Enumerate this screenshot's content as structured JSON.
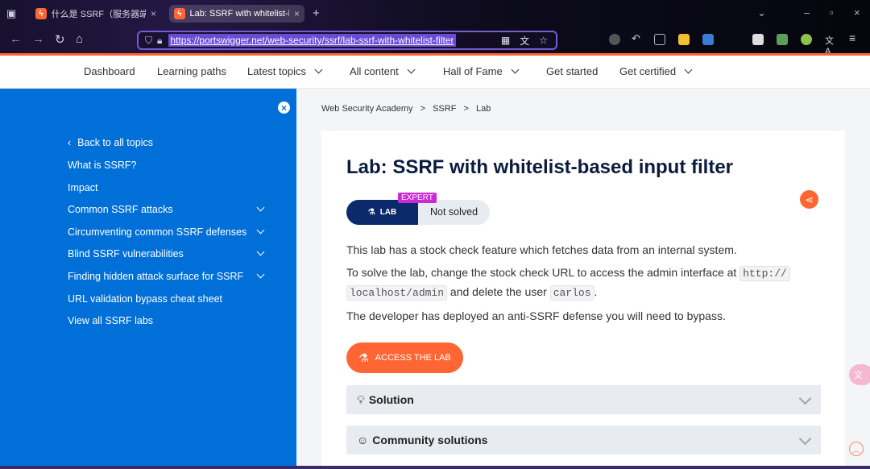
{
  "browser": {
    "tabs": [
      {
        "label": "什么是 SSRF（服务器端请求伪…"
      },
      {
        "label": "Lab: SSRF with whitelist-base"
      }
    ],
    "url": "https://portswigger.net/web-security/ssrf/lab-ssrf-with-whitelist-filter"
  },
  "sitenav": {
    "items": [
      "Dashboard",
      "Learning paths",
      "Latest topics",
      "All content",
      "Hall of Fame",
      "Get started",
      "Get certified"
    ]
  },
  "sidebar": {
    "back_label": "Back to all topics",
    "items": [
      {
        "label": "What is SSRF?"
      },
      {
        "label": "Impact"
      },
      {
        "label": "Common SSRF attacks"
      },
      {
        "label": "Circumventing common SSRF defenses"
      },
      {
        "label": "Blind SSRF vulnerabilities"
      },
      {
        "label": "Finding hidden attack surface for SSRF"
      },
      {
        "label": "URL validation bypass cheat sheet"
      },
      {
        "label": "View all SSRF labs"
      }
    ]
  },
  "breadcrumb": {
    "items": [
      "Web Security Academy",
      "SSRF",
      "Lab"
    ],
    "separator": ">"
  },
  "lab": {
    "title": "Lab: SSRF with whitelist-based input filter",
    "badge_lab": "LAB",
    "level": "EXPERT",
    "status": "Not solved",
    "para1": "This lab has a stock check feature which fetches data from an internal system.",
    "para2_pre": "To solve the lab, change the stock check URL to access the admin interface at",
    "code_url_1": "http://",
    "code_url_2": "localhost/admin",
    "para2_mid": "and delete the user",
    "code_user": "carlos",
    "para2_end": ".",
    "para3": "The developer has deployed an anti-SSRF defense you will need to bypass.",
    "access_button": "ACCESS THE LAB",
    "solution_label": "Solution",
    "community_label": "Community solutions"
  },
  "colors": {
    "accent": "#ff6633",
    "sidebar": "#0070d8",
    "expert": "#c92ad6",
    "title": "#0a1b3d"
  },
  "icons": [
    "tab-menu-icon",
    "back-icon",
    "forward-icon",
    "reload-icon",
    "home-icon",
    "shield-icon",
    "lock-icon",
    "qr-icon",
    "translate-icon",
    "star-icon",
    "close-icon",
    "chevron-down-icon",
    "share-icon",
    "flask-icon",
    "lightbulb-icon",
    "community-icon",
    "scroll-top-icon"
  ]
}
